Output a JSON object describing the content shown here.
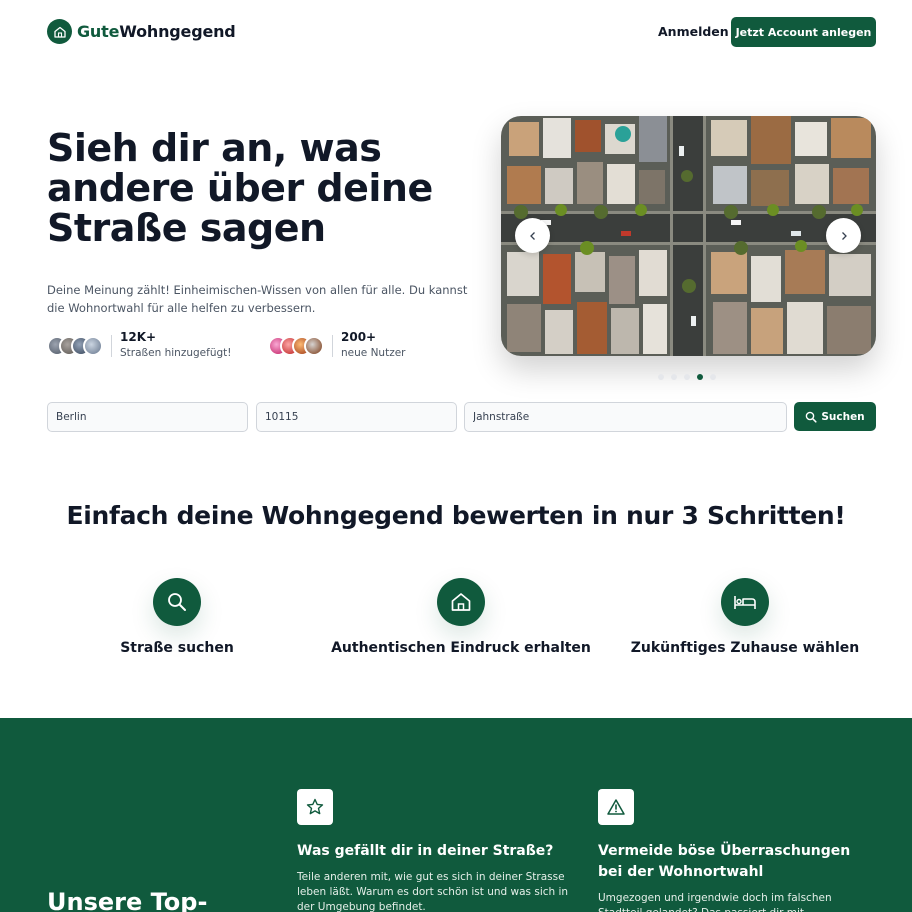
{
  "header": {
    "logo_accent": "Gute",
    "logo_rest": "Wohngegend",
    "login_label": "Anmelden",
    "cta_label": "Jetzt Account anlegen"
  },
  "hero": {
    "title": "Sieh dir an, was andere über deine Straße sagen",
    "description": "Deine Meinung zählt! Einheimischen-Wissen von allen für alle. Du kannst die Wohnortwahl für alle helfen zu verbessern.",
    "stats": [
      {
        "value": "12K+",
        "label": "Straßen hinzugefügt!"
      },
      {
        "value": "200+",
        "label": "neue Nutzer"
      }
    ],
    "carousel": {
      "dot_count": 5,
      "active_index": 3
    }
  },
  "search": {
    "city_value": "Berlin",
    "zip_value": "10115",
    "street_value": "Jahnstraße",
    "button_label": "Suchen"
  },
  "steps": {
    "title": "Einfach deine Wohngegend bewerten in nur 3 Schritten!",
    "items": [
      {
        "label": "Straße suchen",
        "icon": "search-icon"
      },
      {
        "label": "Authentischen Eindruck erhalten",
        "icon": "house-icon"
      },
      {
        "label": "Zukünftiges Zuhause wählen",
        "icon": "bed-icon"
      }
    ]
  },
  "features": {
    "heading": "Unsere Top-",
    "items": [
      {
        "icon": "star-icon",
        "title": "Was gefällt dir in deiner Straße?",
        "text": "Teile anderen mit, wie gut es sich in deiner Strasse leben läßt. Warum es dort schön ist und was sich in der Umgebung befindet."
      },
      {
        "icon": "warning-icon",
        "title": "Vermeide böse Überraschungen bei der Wohnortwahl",
        "text": "Umgezogen und irgendwie doch im falschen Stadtteil gelandet? Das passiert dir mit gutewohngegend.de"
      }
    ]
  },
  "colors": {
    "brand": "#105a3d",
    "text": "#111827",
    "muted": "#4b5563"
  }
}
